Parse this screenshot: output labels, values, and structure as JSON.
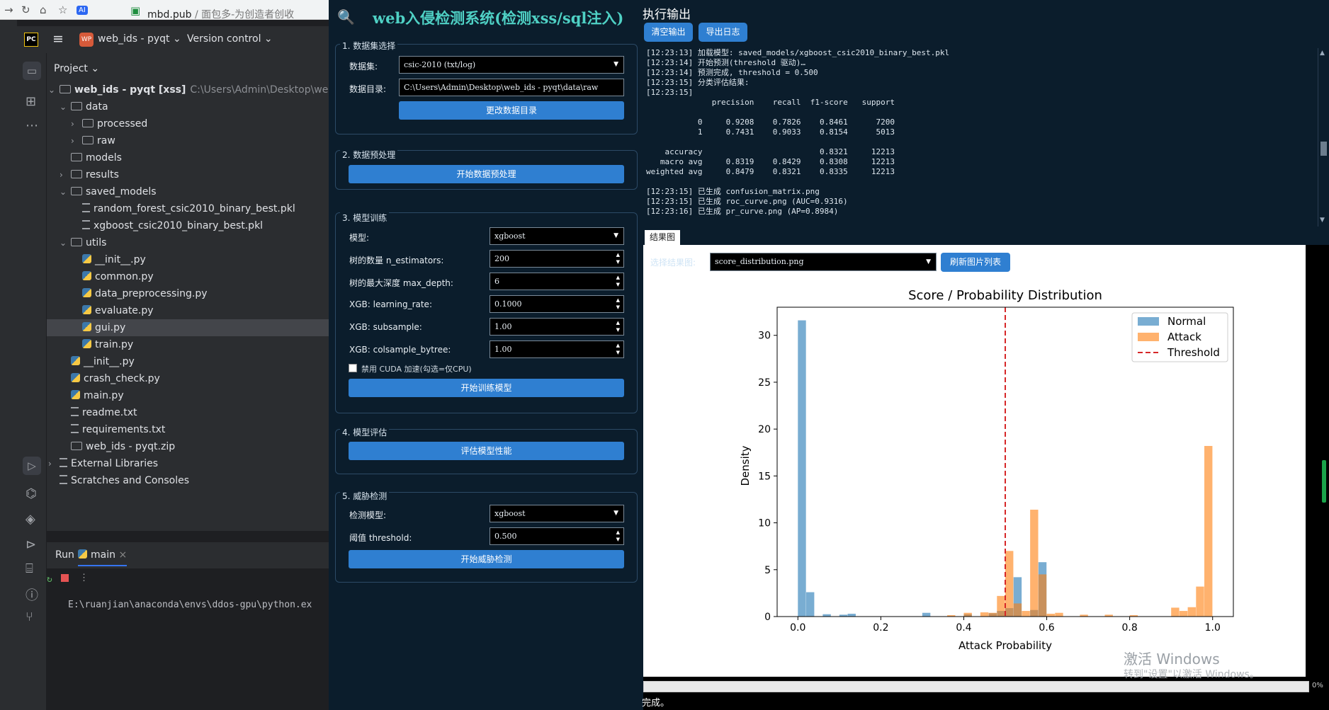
{
  "browser": {
    "domain": "mbd.pub",
    "path": " / 面包多-为创造者创收"
  },
  "ide": {
    "project_badge": "WP",
    "project_name": "web_ids - pyqt",
    "vcs_label": "Version control",
    "project_panel_title": "Project",
    "tree": [
      {
        "label": "web_ids - pyqt [xss]",
        "hint": "C:\\Users\\Admin\\Desktop\\web_ids",
        "type": "folder",
        "depth": 0,
        "arrow": "v"
      },
      {
        "label": "data",
        "type": "folder",
        "depth": 1,
        "arrow": "v"
      },
      {
        "label": "processed",
        "type": "folder",
        "depth": 2,
        "arrow": ">"
      },
      {
        "label": "raw",
        "type": "folder",
        "depth": 2,
        "arrow": ">"
      },
      {
        "label": "models",
        "type": "folder",
        "depth": 1,
        "arrow": ""
      },
      {
        "label": "results",
        "type": "folder",
        "depth": 1,
        "arrow": ">"
      },
      {
        "label": "saved_models",
        "type": "folder",
        "depth": 1,
        "arrow": "v"
      },
      {
        "label": "random_forest_csic2010_binary_best.pkl",
        "type": "text",
        "depth": 2,
        "arrow": ""
      },
      {
        "label": "xgboost_csic2010_binary_best.pkl",
        "type": "text",
        "depth": 2,
        "arrow": ""
      },
      {
        "label": "utils",
        "type": "folder",
        "depth": 1,
        "arrow": "v"
      },
      {
        "label": "__init__.py",
        "type": "py",
        "depth": 2,
        "arrow": ""
      },
      {
        "label": "common.py",
        "type": "py",
        "depth": 2,
        "arrow": ""
      },
      {
        "label": "data_preprocessing.py",
        "type": "py",
        "depth": 2,
        "arrow": ""
      },
      {
        "label": "evaluate.py",
        "type": "py",
        "depth": 2,
        "arrow": ""
      },
      {
        "label": "gui.py",
        "type": "py",
        "depth": 2,
        "arrow": "",
        "selected": true
      },
      {
        "label": "train.py",
        "type": "py",
        "depth": 2,
        "arrow": ""
      },
      {
        "label": "__init__.py",
        "type": "py",
        "depth": 1,
        "arrow": ""
      },
      {
        "label": "crash_check.py",
        "type": "py",
        "depth": 1,
        "arrow": ""
      },
      {
        "label": "main.py",
        "type": "py",
        "depth": 1,
        "arrow": ""
      },
      {
        "label": "readme.txt",
        "type": "text",
        "depth": 1,
        "arrow": ""
      },
      {
        "label": "requirements.txt",
        "type": "text",
        "depth": 1,
        "arrow": ""
      },
      {
        "label": "web_ids - pyqt.zip",
        "type": "zip",
        "depth": 1,
        "arrow": ""
      },
      {
        "label": "External Libraries",
        "type": "lib",
        "depth": 0,
        "arrow": ">"
      },
      {
        "label": "Scratches and Consoles",
        "type": "scratch",
        "depth": 0,
        "arrow": ""
      }
    ],
    "run_tab": "Run",
    "run_config": "main",
    "console_line": "E:\\ruanjian\\anaconda\\envs\\ddos-gpu\\python.ex"
  },
  "app": {
    "title": "web入侵检测系统(检测xss/sql注入)",
    "sections": {
      "dataset": {
        "title": "1. 数据集选择",
        "dataset_label": "数据集:",
        "dataset_value": "csic-2010 (txt/log)",
        "dir_label": "数据目录:",
        "dir_value": "C:\\Users\\Admin\\Desktop\\web_ids - pyqt\\data\\raw",
        "change_dir_button": "更改数据目录"
      },
      "preprocess": {
        "title": "2. 数据预处理",
        "start_button": "开始数据预处理"
      },
      "train": {
        "title": "3. 模型训练",
        "model_label": "模型:",
        "model_value": "xgboost",
        "n_estimators_label": "树的数量 n_estimators:",
        "n_estimators_value": "200",
        "max_depth_label": "树的最大深度 max_depth:",
        "max_depth_value": "6",
        "lr_label": "XGB: learning_rate:",
        "lr_value": "0.1000",
        "subsample_label": "XGB: subsample:",
        "subsample_value": "1.00",
        "colsample_label": "XGB: colsample_bytree:",
        "colsample_value": "1.00",
        "cuda_label": "禁用 CUDA 加速(勾选=仅CPU)",
        "start_button": "开始训练模型"
      },
      "evaluate": {
        "title": "4. 模型评估",
        "button": "评估模型性能"
      },
      "detect": {
        "title": "5. 威胁检测",
        "model_label": "检测模型:",
        "model_value": "xgboost",
        "threshold_label": "阈值 threshold:",
        "threshold_value": "0.500",
        "button": "开始威胁检测"
      }
    },
    "output": {
      "title": "执行输出",
      "clear_button": "清空输出",
      "export_button": "导出日志",
      "log": [
        "[12:23:13] 加载模型: saved_models/xgboost_csic2010_binary_best.pkl",
        "[12:23:14] 开始预测(threshold 驱动)…",
        "[12:23:14] 预测完成, threshold = 0.500",
        "[12:23:15] 分类评估结果:",
        "[12:23:15]",
        "              precision    recall  f1-score   support",
        "",
        "           0     0.9208    0.7826    0.8461      7200",
        "           1     0.7431    0.9033    0.8154      5013",
        "",
        "    accuracy                         0.8321     12213",
        "   macro avg     0.8319    0.8429    0.8308     12213",
        "weighted avg     0.8479    0.8321    0.8335     12213",
        "",
        "[12:23:15] 已生成 confusion_matrix.png",
        "[12:23:15] 已生成 roc_curve.png (AUC=0.9316)",
        "[12:23:16] 已生成 pr_curve.png (AP=0.8984)"
      ]
    },
    "results": {
      "tab": "结果图",
      "select_label": "选择结果图:",
      "image_value": "score_distribution.png",
      "refresh_button": "刷新图片列表"
    },
    "progress_text": "0%",
    "status": "完成。",
    "watermark_line1": "激活 Windows",
    "watermark_line2": "转到\"设置\"以激活 Windows。"
  },
  "chart_data": {
    "type": "bar",
    "title": "Score / Probability Distribution",
    "xlabel": "Attack Probability",
    "ylabel": "Density",
    "xlim": [
      -0.05,
      1.05
    ],
    "ylim": [
      0,
      33
    ],
    "xticks": [
      "0.0",
      "0.2",
      "0.4",
      "0.6",
      "0.8",
      "1.0"
    ],
    "yticks": [
      "0",
      "5",
      "10",
      "15",
      "20",
      "25",
      "30"
    ],
    "legend_position": "top-right",
    "bin_width": 0.02,
    "series": [
      {
        "name": "Normal",
        "color": "#1f77b4",
        "bins": [
          [
            0.0,
            31.6
          ],
          [
            0.02,
            2.6
          ],
          [
            0.06,
            0.25
          ],
          [
            0.1,
            0.2
          ],
          [
            0.12,
            0.3
          ],
          [
            0.3,
            0.4
          ],
          [
            0.4,
            0.25
          ],
          [
            0.46,
            0.35
          ],
          [
            0.48,
            0.6
          ],
          [
            0.5,
            0.9
          ],
          [
            0.52,
            4.2
          ],
          [
            0.56,
            0.7
          ],
          [
            0.58,
            5.8
          ]
        ]
      },
      {
        "name": "Attack",
        "color": "#ff7f0e",
        "bins": [
          [
            0.36,
            0.15
          ],
          [
            0.4,
            0.4
          ],
          [
            0.44,
            0.45
          ],
          [
            0.46,
            0.4
          ],
          [
            0.48,
            2.2
          ],
          [
            0.5,
            7.0
          ],
          [
            0.52,
            1.4
          ],
          [
            0.54,
            0.6
          ],
          [
            0.56,
            11.4
          ],
          [
            0.58,
            4.5
          ],
          [
            0.6,
            0.3
          ],
          [
            0.62,
            0.4
          ],
          [
            0.68,
            0.2
          ],
          [
            0.74,
            0.2
          ],
          [
            0.8,
            0.15
          ],
          [
            0.9,
            0.95
          ],
          [
            0.92,
            0.6
          ],
          [
            0.94,
            1.0
          ],
          [
            0.96,
            3.2
          ],
          [
            0.98,
            18.2
          ]
        ]
      }
    ],
    "threshold": {
      "name": "Threshold",
      "x": 0.5,
      "color": "#d62728"
    }
  }
}
